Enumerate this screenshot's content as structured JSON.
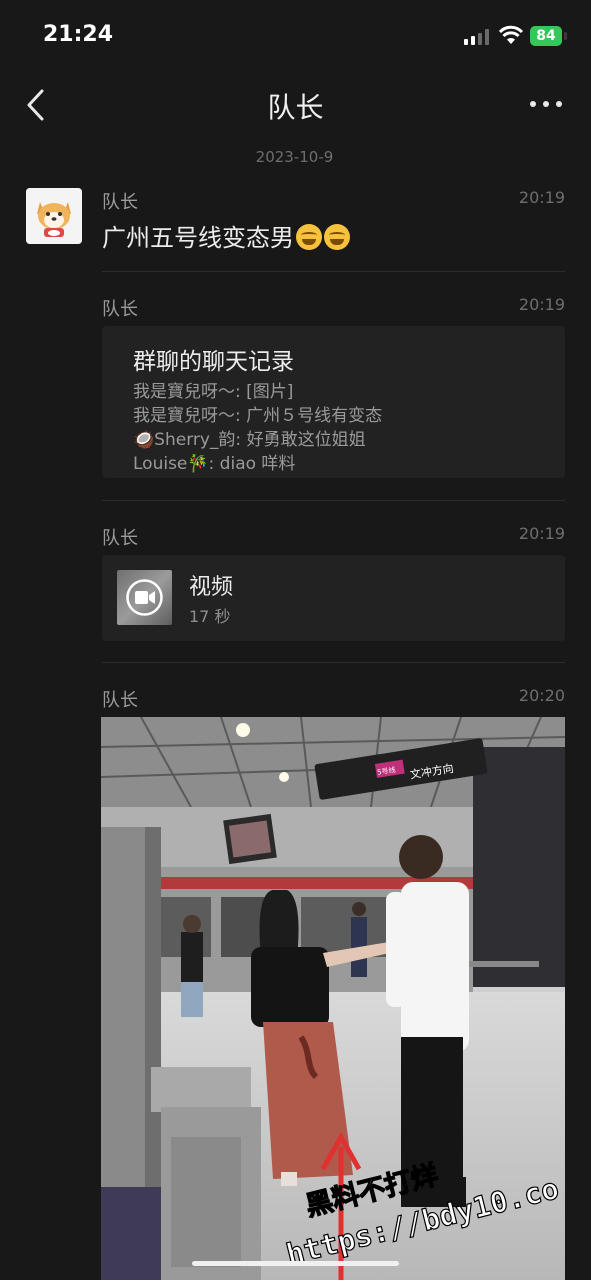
{
  "status_bar": {
    "time": "21:24",
    "battery": "84"
  },
  "nav": {
    "title": "队长"
  },
  "date_separator": "2023-10-9",
  "messages": [
    {
      "sender": "队长",
      "time": "20:19",
      "text": "广州五号线变态男"
    },
    {
      "sender": "队长",
      "time": "20:19",
      "record": {
        "title": "群聊的聊天记录",
        "lines": [
          "我是寶兒呀～: [图片]",
          "我是寶兒呀～: 广州５号线有变态",
          "🥥Sherry_韵: 好勇敢这位姐姐",
          "Louise🎋: diao 咩料"
        ]
      }
    },
    {
      "sender": "队长",
      "time": "20:19",
      "video": {
        "title": "视频",
        "duration": "17 秒"
      }
    },
    {
      "sender": "队长",
      "time": "20:20",
      "image": {
        "signs": {
          "direction": "文冲方向",
          "line": "5号线"
        },
        "watermark": {
          "line1": "黑料不打烊",
          "line2": "https://bdy10.co"
        }
      }
    }
  ],
  "colors": {
    "background": "#181818",
    "card": "#222222",
    "battery": "#34c759",
    "text": "#ececec",
    "muted": "#9a9a9a"
  }
}
